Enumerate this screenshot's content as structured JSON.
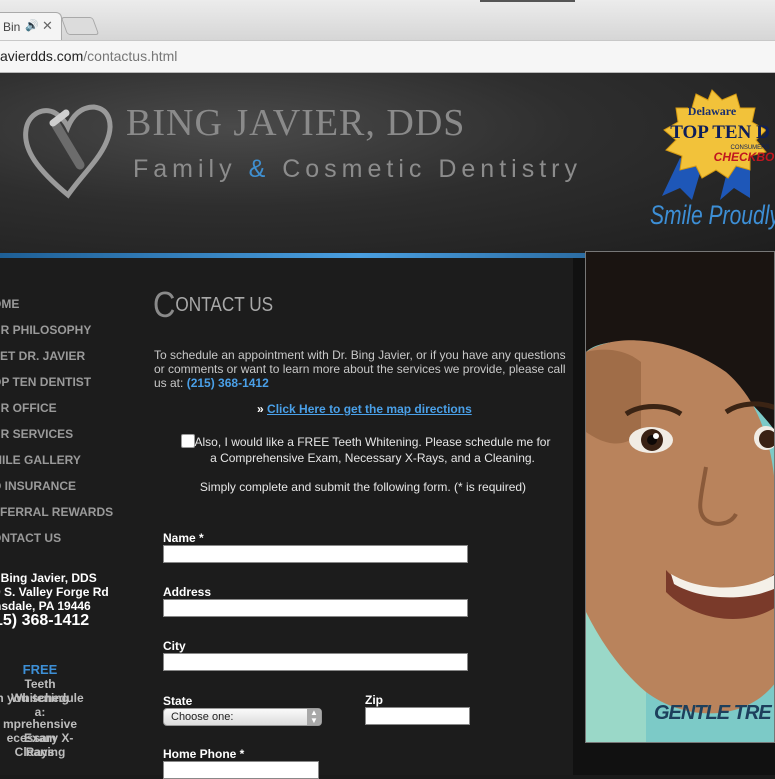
{
  "browser": {
    "tab_title": "Bin",
    "url_host": "avierdds.com",
    "url_path": "/contactus.html"
  },
  "header": {
    "brand_name": "BING JAVIER, DDS",
    "tagline_left": "Family",
    "tagline_amp": "&",
    "tagline_right": "Cosmetic Dentistry",
    "badge_state": "Delaware",
    "badge_title": "TOP TEN D",
    "badge_source": "CHECKBO",
    "badge_small": "CONSUMERS",
    "slogan": "Smile Proudly"
  },
  "nav": [
    {
      "label": "OME"
    },
    {
      "label": "UR PHILOSOPHY"
    },
    {
      "label": "EET DR. JAVIER"
    },
    {
      "label": "OP TEN DENTIST"
    },
    {
      "label": "UR OFFICE"
    },
    {
      "label": "UR SERVICES"
    },
    {
      "label": "MILE GALLERY"
    },
    {
      "label": "O INSURANCE"
    },
    {
      "label": "EFERRAL REWARDS"
    },
    {
      "label": "ONTACT US"
    }
  ],
  "sidebar": {
    "address_line1": ". Bing Javier, DDS",
    "address_line2": "0 S. Valley Forge Rd",
    "address_line3": "nsdale, PA 19446",
    "phone": "15) 368-1412",
    "promo_free": "FREE",
    "promo_line1": "Teeth Whitening",
    "promo_line2": "n you schedule a:",
    "promo_line3": "mprehensive Exam",
    "promo_line4": "ecessary X-Rays",
    "promo_line5": "Cleaning"
  },
  "content": {
    "title_initial": "C",
    "title_rest": "ONTACT US",
    "intro": "To schedule an appointment with Dr. Bing Javier, or if you have any questions or comments or want to learn more about the services we provide, please call us at:",
    "intro_phone": "(215) 368-1412",
    "map_prefix": "»",
    "map_link": "Click Here to get the map directions",
    "whitening_text": "Also, I would like a FREE Teeth Whitening. Please schedule me for a Comprehensive Exam, Necessary X-Rays, and a Cleaning.",
    "instructions": "Simply complete and submit the following form. (* is required)"
  },
  "form": {
    "name_label": "Name *",
    "address_label": "Address",
    "city_label": "City",
    "state_label": "State",
    "state_value": "Choose one:",
    "zip_label": "Zip",
    "home_phone_label": "Home Phone *"
  },
  "photo": {
    "caption": "GENTLE TRE"
  }
}
